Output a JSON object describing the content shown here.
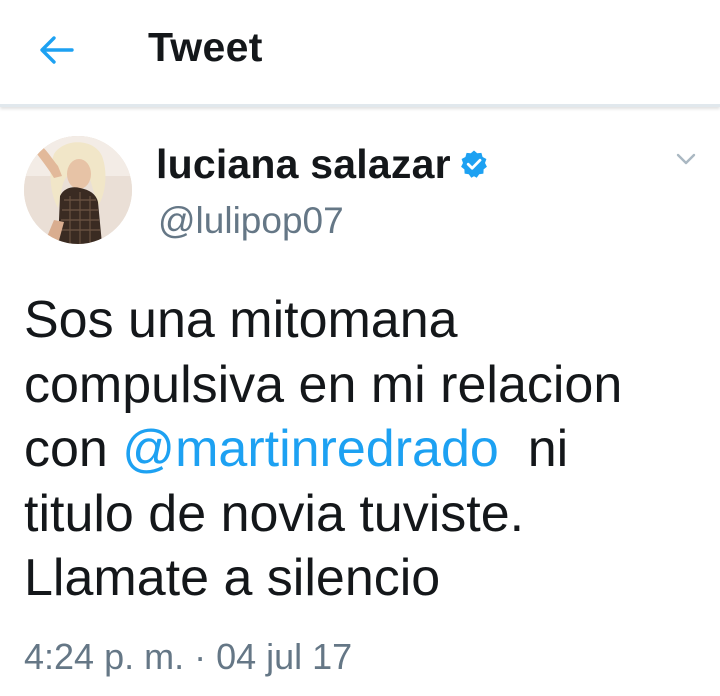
{
  "header": {
    "title": "Tweet"
  },
  "author": {
    "display_name": "luciana salazar",
    "handle": "@lulipop07",
    "verified": true
  },
  "tweet": {
    "line1": "Sos una mitomana",
    "line2": "compulsiva en mi relacion",
    "line3_prefix": "con ",
    "mention": "@martinredrado",
    "line3_suffix": "  ni",
    "line4": "titulo de novia tuviste.",
    "line5": "Llamate a silencio"
  },
  "meta": {
    "timestamp": "4:24 p. m. · 04 jul 17"
  },
  "colors": {
    "accent": "#1da1f2",
    "text_primary": "#14171a",
    "text_secondary": "#657786",
    "divider": "#e1e8ed"
  },
  "icons": {
    "back": "arrow-left-icon",
    "verified": "verified-badge-icon",
    "menu": "chevron-down-icon"
  }
}
